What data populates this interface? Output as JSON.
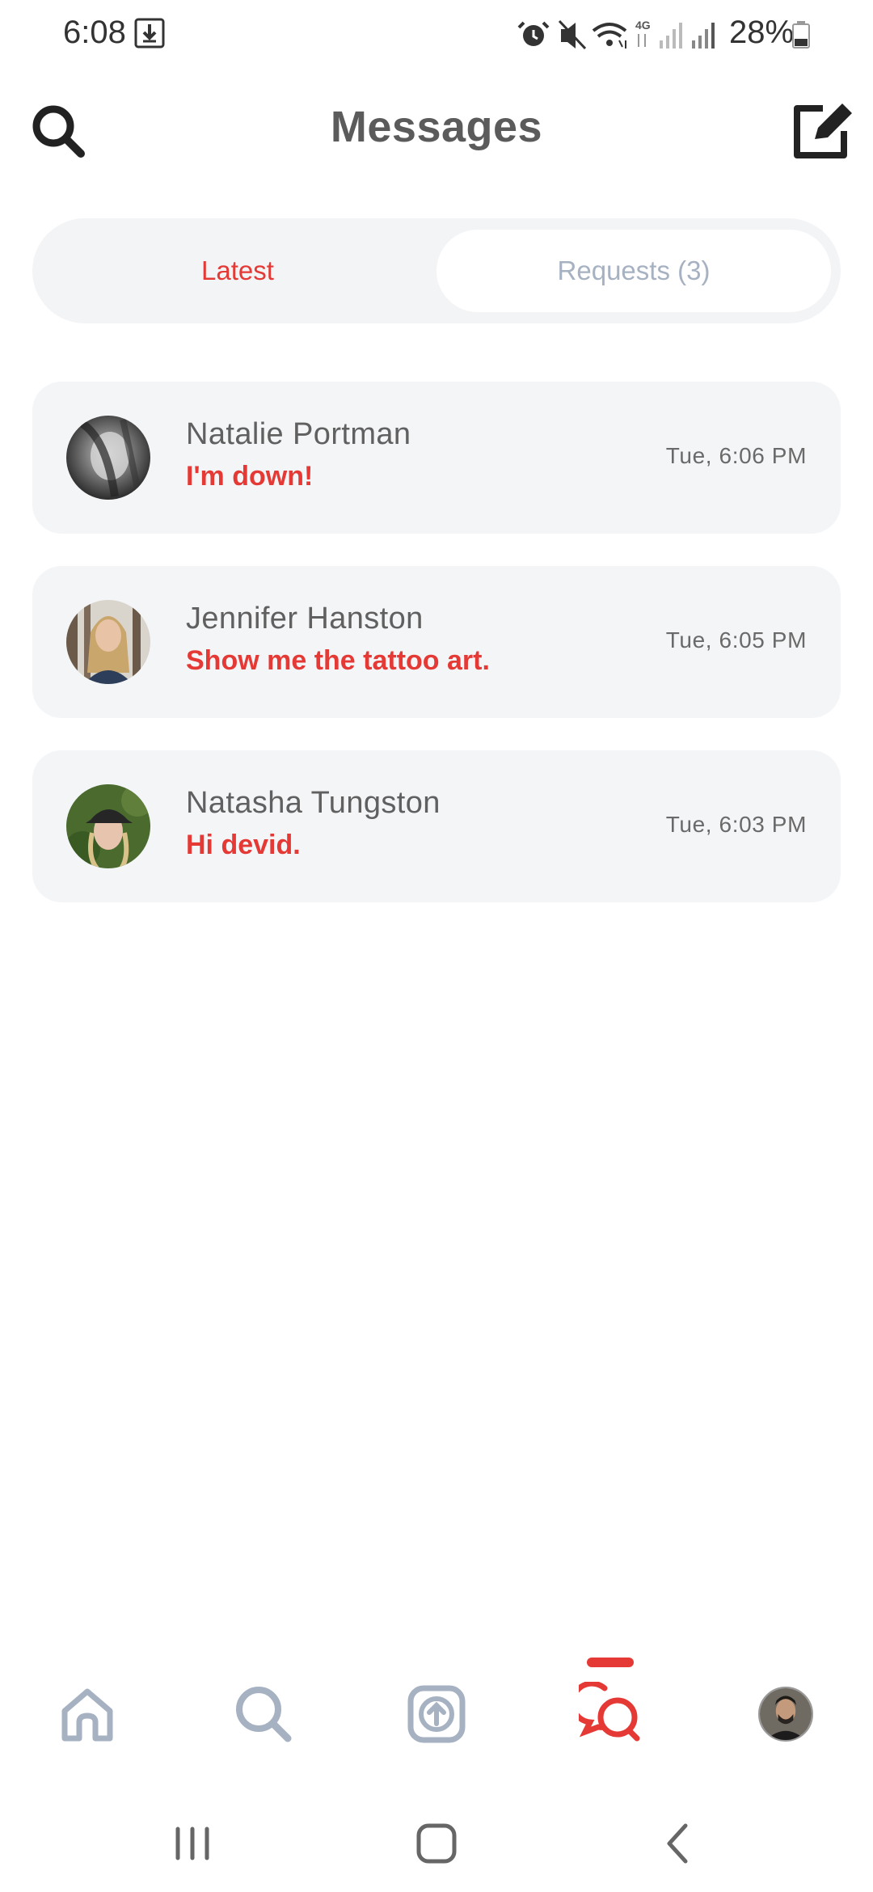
{
  "status_bar": {
    "time": "6:08",
    "battery_percent": "28%",
    "icons": [
      "download-icon",
      "alarm-icon",
      "mute-icon",
      "wifi-icon",
      "4g-icon",
      "signal-icon",
      "signal-icon",
      "battery-icon"
    ]
  },
  "header": {
    "title": "Messages",
    "left_icon": "search-icon",
    "right_icon": "compose-icon"
  },
  "tabs": [
    {
      "label": "Latest",
      "active": true
    },
    {
      "label": "Requests (3)",
      "active": false
    }
  ],
  "messages": [
    {
      "name": "Natalie Portman",
      "text": "I'm down!",
      "time": "Tue, 6:06 PM"
    },
    {
      "name": "Jennifer Hanston",
      "text": "Show me the tattoo art.",
      "time": "Tue, 6:05 PM"
    },
    {
      "name": "Natasha Tungston",
      "text": "Hi devid.",
      "time": "Tue, 6:03 PM"
    }
  ],
  "bottom_nav": {
    "items": [
      "home-icon",
      "search-icon",
      "upload-icon",
      "messages-icon",
      "profile-avatar"
    ],
    "active": "messages-icon"
  },
  "system_nav": [
    "recent-apps-icon",
    "home-icon",
    "back-icon"
  ],
  "colors": {
    "accent": "#e53935",
    "inactive": "#a6b1c2",
    "card_bg": "#f4f5f7"
  }
}
